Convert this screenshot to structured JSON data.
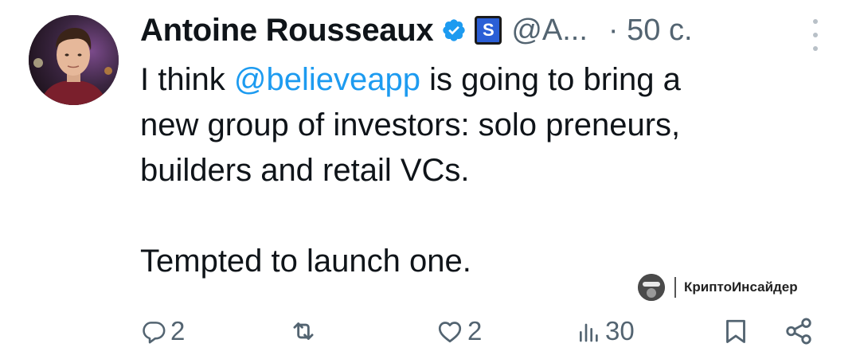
{
  "tweet": {
    "author_name": "Antoine Rousseaux",
    "org_badge_letter": "S",
    "handle": "@A...",
    "time": "· 50 с.",
    "text_lines": [
      {
        "before": "I think ",
        "mention": "@believeapp",
        "after": " is going to bring a"
      },
      {
        "text": "new group of investors: solo preneurs,"
      },
      {
        "text": "builders and retail VCs."
      },
      {
        "text": ""
      },
      {
        "text": "Tempted to launch one."
      }
    ]
  },
  "actions": {
    "replies": "2",
    "retweets": "",
    "likes": "2",
    "views": "30"
  },
  "watermark": {
    "text": "КриптоИнсайдер"
  },
  "icons": [
    "verified-badge-icon",
    "reply-icon",
    "retweet-icon",
    "like-icon",
    "views-icon",
    "bookmark-icon",
    "share-icon",
    "more-icon"
  ],
  "colors": {
    "mention": "#1d9bf0",
    "verified": "#1d9bf0",
    "secondary_text": "#536471",
    "org_badge": "#2b5fd6"
  }
}
